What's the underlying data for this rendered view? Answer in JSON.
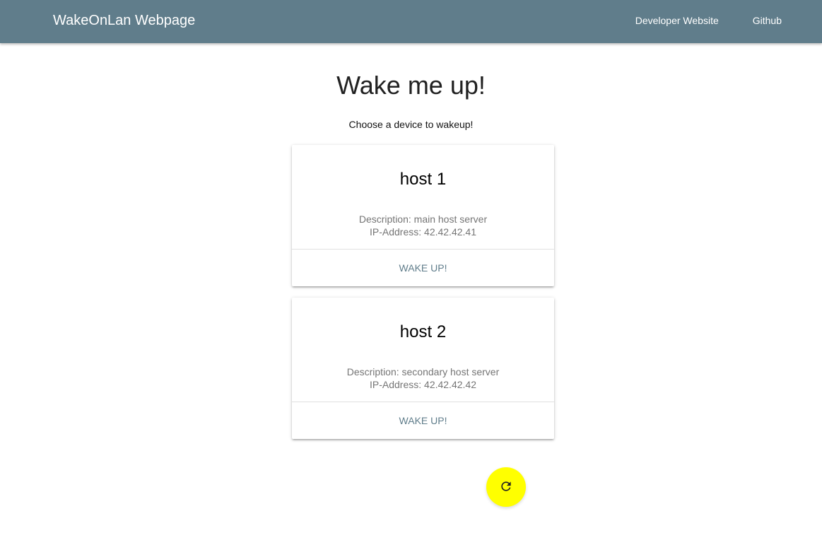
{
  "navbar": {
    "brand": "WakeOnLan Webpage",
    "links": [
      {
        "label": "Developer Website"
      },
      {
        "label": "Github"
      }
    ]
  },
  "main": {
    "title": "Wake me up!",
    "subtitle": "Choose a device to wakeup!"
  },
  "devices": [
    {
      "name": "host 1",
      "description": "Description: main host server",
      "ip": "IP-Address: 42.42.42.41",
      "action_label": "WAKE UP!"
    },
    {
      "name": "host 2",
      "description": "Description: secondary host server",
      "ip": "IP-Address: 42.42.42.42",
      "action_label": "WAKE UP!"
    }
  ],
  "refresh_button": {
    "icon": "refresh-icon",
    "color": "#ffff00"
  },
  "colors": {
    "navbar": "#607d8b",
    "accent": "#607d8b"
  }
}
